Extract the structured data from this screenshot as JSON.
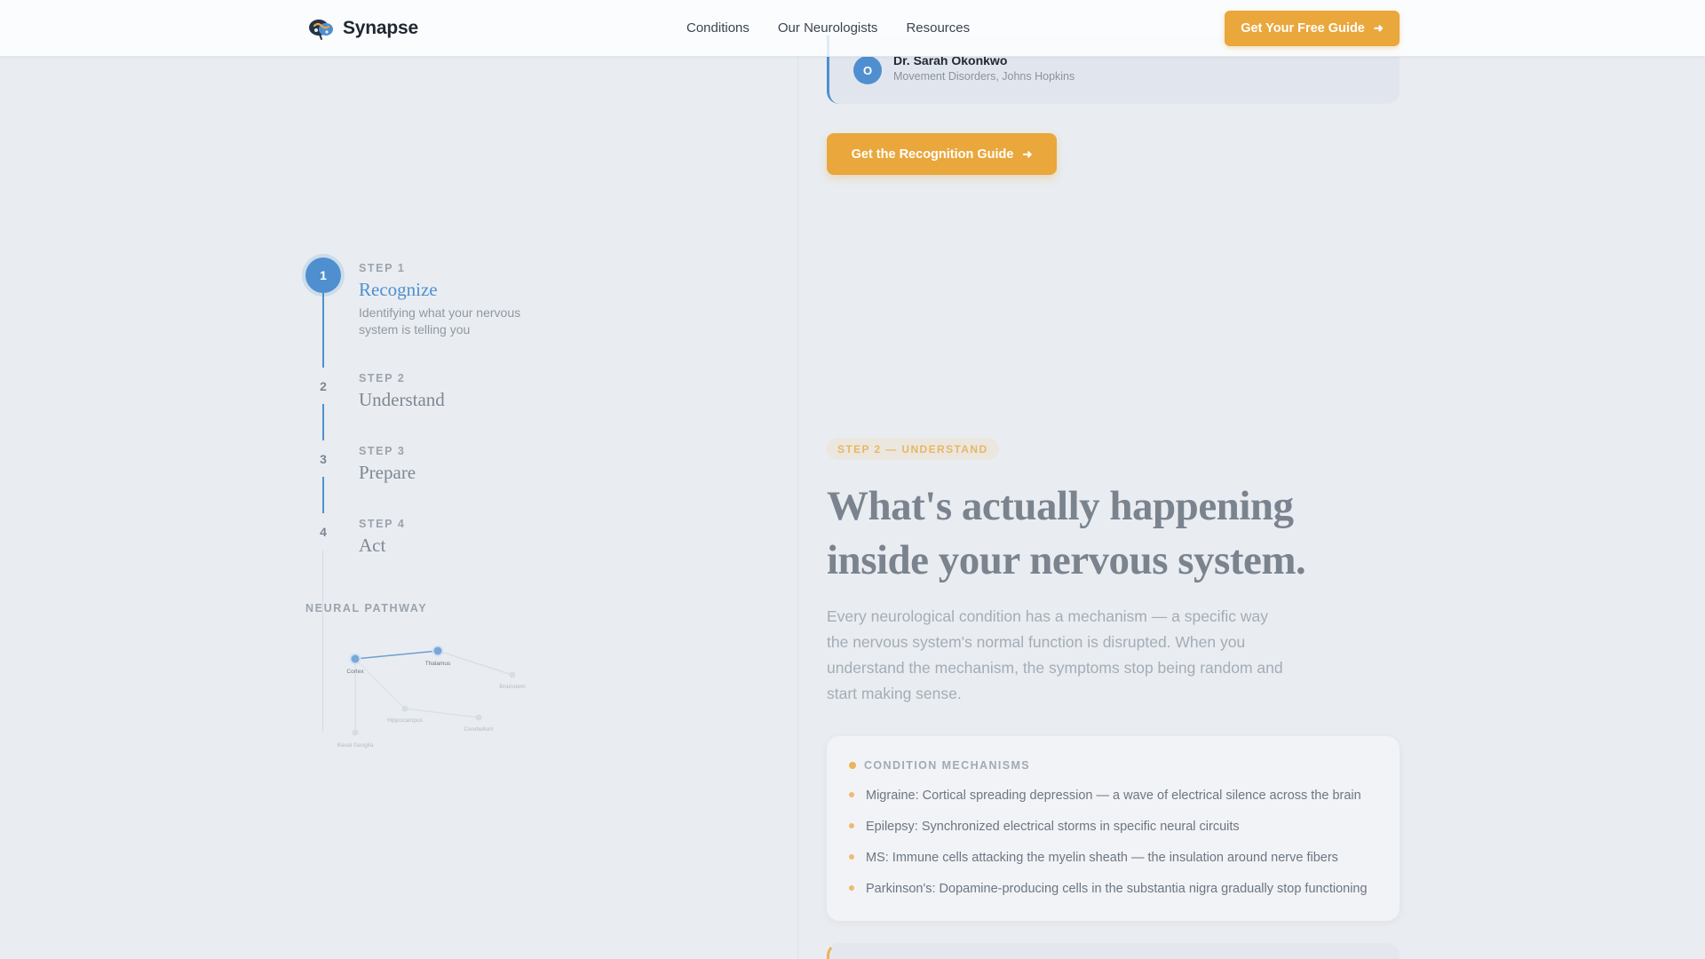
{
  "header": {
    "brand": "Synapse",
    "nav": [
      "Conditions",
      "Our Neurologists",
      "Resources"
    ],
    "cta_label": "Get Your Free Guide"
  },
  "stepper": {
    "steps": [
      {
        "label": "STEP 1",
        "number": "1",
        "title": "Recognize",
        "desc": "Identifying what your nervous system is telling you",
        "active": true
      },
      {
        "label": "STEP 2",
        "number": "2",
        "title": "Understand"
      },
      {
        "label": "STEP 3",
        "number": "3",
        "title": "Prepare"
      },
      {
        "label": "STEP 4",
        "number": "4",
        "title": "Act"
      }
    ],
    "pathway_label": "NEURAL PATHWAY",
    "pathway_nodes": [
      "Cortex",
      "Thalamus",
      "Brainstem",
      "Hippocampus",
      "Cerebellum",
      "Basal Ganglia"
    ]
  },
  "quote": {
    "initial": "O",
    "name": "Dr. Sarah Okonkwo",
    "role": "Movement Disorders, Johns Hopkins"
  },
  "guide_button_label": "Get the Recognition Guide",
  "section": {
    "tag": "STEP 2 — UNDERSTAND",
    "heading": "What's actually happening inside your nervous system.",
    "intro": "Every neurological condition has a mechanism — a specific way the nervous system's normal function is disrupted. When you understand the mechanism, the symptoms stop being random and start making sense."
  },
  "mechanisms": {
    "title": "CONDITION MECHANISMS",
    "items": [
      "Migraine: Cortical spreading depression — a wave of electrical silence across the brain",
      "Epilepsy: Synchronized electrical storms in specific neural circuits",
      "MS: Immune cells attacking the myelin sheath — the insulation around nerve fibers",
      "Parkinson's: Dopamine-producing cells in the substantia nigra gradually stop functioning"
    ]
  },
  "colors": {
    "accent_blue": "#4f8fd0",
    "accent_orange": "#e9a73c",
    "background": "#e9edf1"
  }
}
